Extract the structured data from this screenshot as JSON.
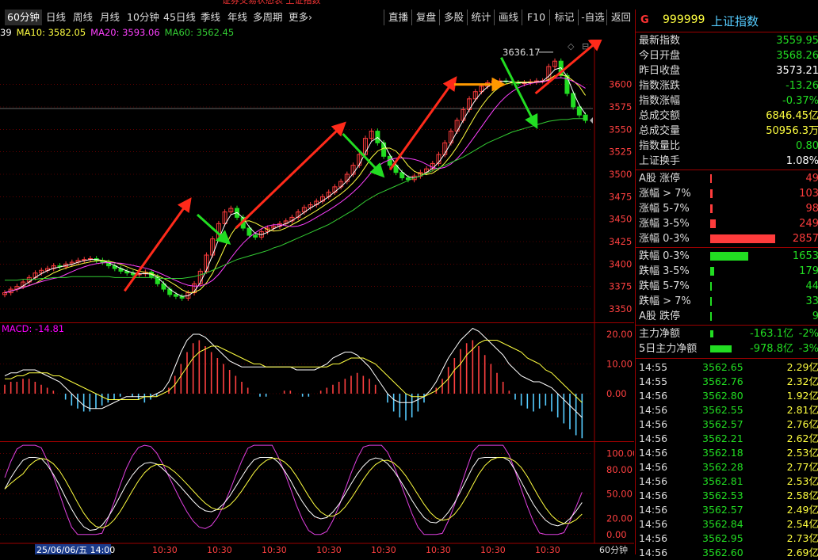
{
  "colors": {
    "up": "#ff3c3c",
    "down": "#22dd22",
    "ma5": "#ffffff",
    "ma10": "#ffff40",
    "ma20": "#ff40ff",
    "ma60": "#33cc33",
    "grid": "#9b0000",
    "dif": "#ffffff",
    "dea": "#ffff40",
    "arrow": "#ff2a1a"
  },
  "window": {
    "top_caption": "证券交易状态表 上证指数"
  },
  "periods": [
    "60分钟",
    "日线",
    "周线",
    "月线",
    "10分钟",
    "45日线",
    "季线",
    "年线",
    "多周期",
    "更多›"
  ],
  "active_period": "60分钟",
  "tools": [
    "直播",
    "复盘",
    "多股",
    "统计",
    "画线",
    "F10",
    "标记",
    "-自选",
    "返回"
  ],
  "ma_legend": [
    {
      "label": "39",
      "color": "#ffffff"
    },
    {
      "label": "MA10: 3582.05",
      "color": "#ffff40"
    },
    {
      "label": "MA20: 3593.06",
      "color": "#ff40ff"
    },
    {
      "label": "MA60: 3562.45",
      "color": "#33cc33"
    }
  ],
  "chart_data": {
    "type": "line",
    "title": "上证指数 60分钟",
    "price_axis": {
      "ticks": [
        3600,
        3575,
        3550,
        3525,
        3500,
        3475,
        3450,
        3425,
        3400,
        3375,
        3350
      ],
      "range": [
        3335,
        3650
      ]
    },
    "peak_annotation": "3636.17",
    "x_labels": [
      "10:30",
      "10:30",
      "10:30",
      "10:30",
      "10:30",
      "10:30",
      "10:30",
      "10:30"
    ],
    "cursor_date": "25/06/06/五 14:00",
    "price_series": [
      3368,
      3372,
      3375,
      3380,
      3385,
      3390,
      3393,
      3395,
      3398,
      3397,
      3400,
      3402,
      3404,
      3405,
      3406,
      3404,
      3402,
      3398,
      3395,
      3392,
      3390,
      3388,
      3389,
      3391,
      3386,
      3378,
      3372,
      3366,
      3364,
      3362,
      3368,
      3378,
      3392,
      3410,
      3428,
      3445,
      3458,
      3462,
      3452,
      3440,
      3432,
      3430,
      3436,
      3440,
      3442,
      3445,
      3448,
      3452,
      3458,
      3463,
      3466,
      3470,
      3475,
      3480,
      3486,
      3492,
      3500,
      3510,
      3522,
      3540,
      3548,
      3535,
      3520,
      3510,
      3502,
      3496,
      3494,
      3498,
      3502,
      3506,
      3512,
      3522,
      3535,
      3548,
      3560,
      3572,
      3584,
      3592,
      3598,
      3602,
      3604,
      3604,
      3603,
      3602,
      3601,
      3602,
      3603,
      3604,
      3604,
      3620,
      3626,
      3610,
      3590,
      3575,
      3566,
      3560
    ],
    "ma60_series": [
      3382,
      3382,
      3382,
      3383,
      3383,
      3383,
      3384,
      3384,
      3385,
      3385,
      3385,
      3386,
      3386,
      3386,
      3386,
      3386,
      3386,
      3386,
      3385,
      3385,
      3385,
      3385,
      3385,
      3385,
      3385,
      3384,
      3384,
      3384,
      3384,
      3384,
      3385,
      3386,
      3388,
      3390,
      3393,
      3396,
      3399,
      3402,
      3405,
      3407,
      3409,
      3411,
      3413,
      3415,
      3418,
      3420,
      3423,
      3426,
      3429,
      3432,
      3435,
      3438,
      3441,
      3444,
      3448,
      3452,
      3456,
      3460,
      3465,
      3470,
      3474,
      3478,
      3481,
      3484,
      3487,
      3490,
      3493,
      3496,
      3498,
      3501,
      3504,
      3507,
      3510,
      3513,
      3516,
      3519,
      3523,
      3527,
      3531,
      3535,
      3538,
      3541,
      3544,
      3547,
      3549,
      3551,
      3553,
      3555,
      3557,
      3559,
      3560,
      3561,
      3561,
      3562,
      3562,
      3562
    ],
    "macd": {
      "label": "MACD: -14.81",
      "ticks": [
        20,
        10,
        0
      ],
      "range": [
        -16,
        24
      ],
      "bars": [
        3,
        4,
        4,
        5,
        5,
        4,
        3,
        2,
        1,
        0,
        -2,
        -4,
        -5,
        -6,
        -6,
        -5,
        -4,
        -3,
        -2,
        -1,
        0,
        -1,
        -2,
        -3,
        -2,
        -1,
        0,
        2,
        6,
        10,
        14,
        17,
        18,
        16,
        14,
        12,
        10,
        8,
        6,
        4,
        2,
        0,
        -1,
        -1,
        0,
        0,
        1,
        1,
        0,
        -1,
        -1,
        0,
        1,
        2,
        3,
        4,
        5,
        6,
        7,
        6,
        5,
        3,
        0,
        -3,
        -6,
        -8,
        -9,
        -8,
        -6,
        -3,
        0,
        2,
        5,
        9,
        12,
        15,
        17,
        18,
        16,
        13,
        10,
        7,
        4,
        1,
        -2,
        -4,
        -5,
        -6,
        -5,
        -4,
        -6,
        -8,
        -10,
        -12,
        -14,
        -15
      ],
      "dif": [
        6,
        7,
        7,
        8,
        8,
        8,
        7,
        6,
        5,
        4,
        2,
        0,
        -2,
        -4,
        -5,
        -5,
        -5,
        -4,
        -3,
        -2,
        -1,
        -1,
        -1,
        -1,
        -1,
        0,
        1,
        4,
        9,
        14,
        18,
        20,
        20,
        19,
        17,
        15,
        13,
        11,
        10,
        9,
        9,
        9,
        9,
        9,
        9,
        9,
        9,
        9,
        8,
        8,
        8,
        8,
        9,
        10,
        12,
        13,
        14,
        14,
        13,
        11,
        9,
        6,
        3,
        0,
        -2,
        -3,
        -3,
        -3,
        -2,
        -1,
        1,
        4,
        8,
        12,
        15,
        18,
        20,
        22,
        21,
        19,
        17,
        15,
        13,
        10,
        8,
        6,
        5,
        4,
        4,
        3,
        2,
        0,
        -2,
        -4,
        -6,
        -8
      ],
      "dea": [
        5,
        5,
        6,
        6,
        7,
        7,
        7,
        7,
        6,
        6,
        5,
        4,
        3,
        2,
        1,
        0,
        -1,
        -2,
        -2,
        -2,
        -2,
        -2,
        -2,
        -1,
        -1,
        -1,
        0,
        1,
        3,
        6,
        9,
        12,
        14,
        15,
        16,
        16,
        15,
        14,
        13,
        12,
        11,
        10,
        10,
        9,
        9,
        9,
        9,
        9,
        9,
        9,
        9,
        9,
        9,
        9,
        10,
        10,
        11,
        12,
        12,
        12,
        11,
        10,
        8,
        6,
        4,
        2,
        0,
        -1,
        -1,
        -1,
        0,
        1,
        3,
        5,
        8,
        10,
        13,
        15,
        17,
        18,
        18,
        18,
        17,
        16,
        15,
        14,
        12,
        11,
        10,
        8,
        7,
        5,
        3,
        1,
        -1,
        -3
      ]
    },
    "kdj": {
      "ticks": [
        100,
        80,
        50,
        20,
        0
      ],
      "range": [
        -10,
        115
      ]
    }
  },
  "panel": {
    "code": "999999",
    "name": "上证指数",
    "quote": [
      {
        "label": "最新指数",
        "value": "3559.95",
        "color": "#22dd22"
      },
      {
        "label": "今日开盘",
        "value": "3568.26",
        "color": "#22dd22"
      },
      {
        "label": "昨日收盘",
        "value": "3573.21",
        "color": "#ffffff"
      },
      {
        "label": "指数涨跌",
        "value": "-13.26",
        "color": "#22dd22"
      },
      {
        "label": "指数涨幅",
        "value": "-0.37%",
        "color": "#22dd22"
      },
      {
        "label": "总成交额",
        "value": "6846.45亿",
        "color": "#ffff40"
      },
      {
        "label": "总成交量",
        "value": "50956.3万",
        "color": "#ffff40"
      },
      {
        "label": "指数量比",
        "value": "0.80",
        "color": "#22dd22"
      },
      {
        "label": "上证换手",
        "value": "1.08%",
        "color": "#ffffff"
      }
    ],
    "breadth_up": [
      {
        "label": "A股 涨停",
        "value": "49",
        "bar": 0.02
      },
      {
        "label": "涨幅 > 7%",
        "value": "103",
        "bar": 0.04
      },
      {
        "label": "涨幅 5-7%",
        "value": "98",
        "bar": 0.04
      },
      {
        "label": "涨幅 3-5%",
        "value": "249",
        "bar": 0.09
      },
      {
        "label": "涨幅 0-3%",
        "value": "2857",
        "bar": 1.0
      }
    ],
    "breadth_down": [
      {
        "label": "跌幅 0-3%",
        "value": "1653",
        "bar": 0.58
      },
      {
        "label": "跌幅 3-5%",
        "value": "179",
        "bar": 0.06
      },
      {
        "label": "跌幅 5-7%",
        "value": "44",
        "bar": 0.02
      },
      {
        "label": "跌幅 > 7%",
        "value": "33",
        "bar": 0.01
      },
      {
        "label": "A股 跌停",
        "value": "9",
        "bar": 0.005
      }
    ],
    "flows": [
      {
        "label": "主力净额",
        "value": "-163.1亿",
        "pct": "-2%",
        "bar": 0.05
      },
      {
        "label": "5日主力净额",
        "value": "-978.8亿",
        "pct": "-3%",
        "bar": 0.33
      }
    ],
    "ticks": [
      {
        "time": "14:55",
        "price": "3562.65",
        "amt": "2.29亿"
      },
      {
        "time": "14:55",
        "price": "3562.76",
        "amt": "2.32亿"
      },
      {
        "time": "14:56",
        "price": "3562.80",
        "amt": "1.92亿"
      },
      {
        "time": "14:56",
        "price": "3562.55",
        "amt": "2.81亿"
      },
      {
        "time": "14:56",
        "price": "3562.57",
        "amt": "2.76亿"
      },
      {
        "time": "14:56",
        "price": "3562.21",
        "amt": "2.62亿"
      },
      {
        "time": "14:56",
        "price": "3562.18",
        "amt": "2.53亿"
      },
      {
        "time": "14:56",
        "price": "3562.28",
        "amt": "2.77亿"
      },
      {
        "time": "14:56",
        "price": "3562.81",
        "amt": "2.53亿"
      },
      {
        "time": "14:56",
        "price": "3562.53",
        "amt": "2.58亿"
      },
      {
        "time": "14:56",
        "price": "3562.57",
        "amt": "2.49亿"
      },
      {
        "time": "14:56",
        "price": "3562.84",
        "amt": "2.54亿"
      },
      {
        "time": "14:56",
        "price": "3562.95",
        "amt": "2.73亿"
      },
      {
        "time": "14:56",
        "price": "3562.60",
        "amt": "2.69亿"
      }
    ]
  }
}
